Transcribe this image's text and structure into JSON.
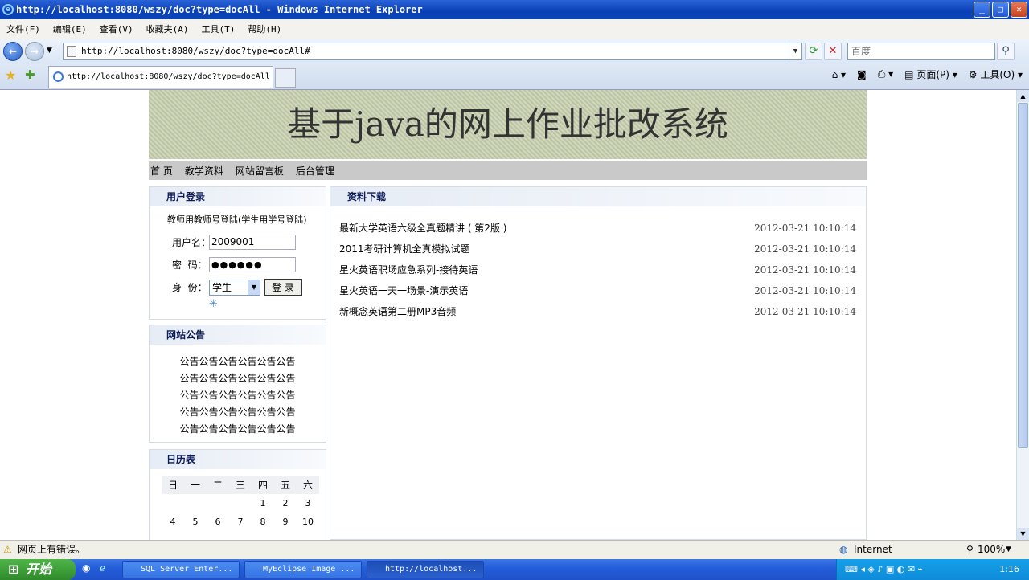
{
  "window": {
    "title": "http://localhost:8080/wszy/doc?type=docAll - Windows Internet Explorer"
  },
  "menu": [
    "文件(F)",
    "编辑(E)",
    "查看(V)",
    "收藏夹(A)",
    "工具(T)",
    "帮助(H)"
  ],
  "address": "http://localhost:8080/wszy/doc?type=docAll#",
  "search_placeholder": "百度",
  "tab_title": "http://localhost:8080/wszy/doc?type=docAll",
  "commands": {
    "page": "页面(P)",
    "tools": "工具(O)"
  },
  "site": {
    "banner": "基于java的网上作业批改系统",
    "nav": [
      "首 页",
      "教学资料",
      "网站留言板",
      "后台管理"
    ],
    "login": {
      "title": "用户登录",
      "note": "教师用教师号登陆(学生用学号登陆)",
      "user_label": "用户名：",
      "user_value": "2009001",
      "pwd_label": "密  码：",
      "pwd_value": "●●●●●●",
      "role_label": "身  份：",
      "role_value": "学生",
      "submit": "登 录"
    },
    "notice": {
      "title": "网站公告",
      "items": [
        "公告公告公告公告公告公告",
        "公告公告公告公告公告公告",
        "公告公告公告公告公告公告",
        "公告公告公告公告公告公告",
        "公告公告公告公告公告公告"
      ]
    },
    "calendar": {
      "title": "日历表",
      "weekdays": [
        "日",
        "一",
        "二",
        "三",
        "四",
        "五",
        "六"
      ],
      "rows": [
        [
          "",
          "",
          "",
          "",
          "1",
          "2",
          "3"
        ],
        [
          "4",
          "5",
          "6",
          "7",
          "8",
          "9",
          "10"
        ]
      ]
    },
    "docs": {
      "title": "资料下载",
      "items": [
        {
          "name": "最新大学英语六级全真题精讲 ( 第2版 )",
          "date": "2012-03-21 10:10:14"
        },
        {
          "name": "2011考研计算机全真模拟试题",
          "date": "2012-03-21 10:10:14"
        },
        {
          "name": "星火英语职场应急系列-接待英语",
          "date": "2012-03-21 10:10:14"
        },
        {
          "name": "星火英语一天一场景-演示英语",
          "date": "2012-03-21 10:10:14"
        },
        {
          "name": "新概念英语第二册MP3音频",
          "date": "2012-03-21 10:10:14"
        }
      ]
    }
  },
  "status": {
    "text": "网页上有错误。",
    "zone": "Internet",
    "zoom": "100%"
  },
  "taskbar": {
    "start": "开始",
    "tasks": [
      "SQL Server Enter...",
      "MyEclipse Image ...",
      "http://localhost..."
    ],
    "time": "1:16"
  }
}
